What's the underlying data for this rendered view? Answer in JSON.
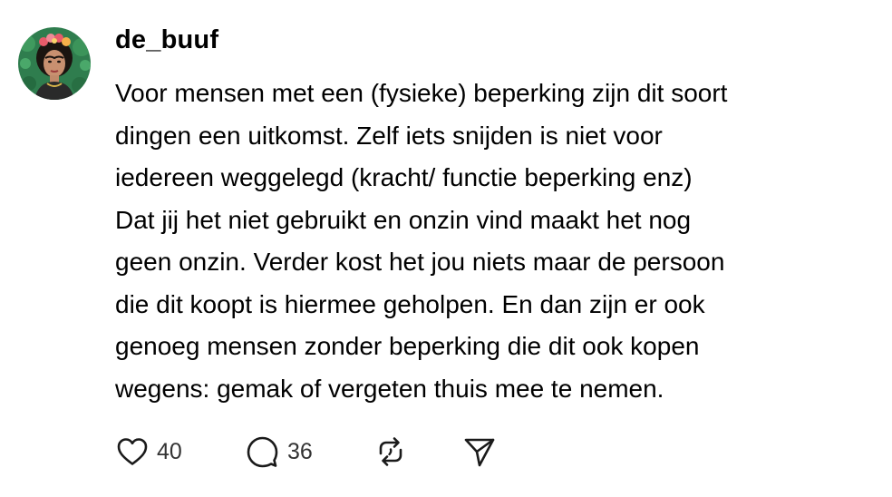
{
  "post": {
    "username": "de_buuf",
    "avatar_icon": "profile-avatar-portrait",
    "text": "Voor mensen met een (fysieke) beperking zijn dit soort\ndingen een uitkomst. Zelf iets snijden is niet voor\niedereen weggelegd (kracht/ functie beperking enz)\nDat jij het niet gebruikt en onzin vind maakt het nog\ngeen onzin. Verder kost het jou niets maar de persoon\ndie dit koopt is hiermee geholpen. En dan zijn er ook\ngenoeg mensen zonder beperking die dit ook kopen\nwegens: gemak of vergeten thuis mee te nemen.",
    "actions": {
      "like_icon": "heart-icon",
      "like_count": "40",
      "reply_icon": "speech-bubble-icon",
      "reply_count": "36",
      "repost_icon": "repost-icon",
      "share_icon": "send-icon"
    }
  },
  "colors": {
    "text": "#000000",
    "count": "#333333",
    "icon": "#1a1a1a",
    "avatar_bg": "#2e7d4f"
  }
}
